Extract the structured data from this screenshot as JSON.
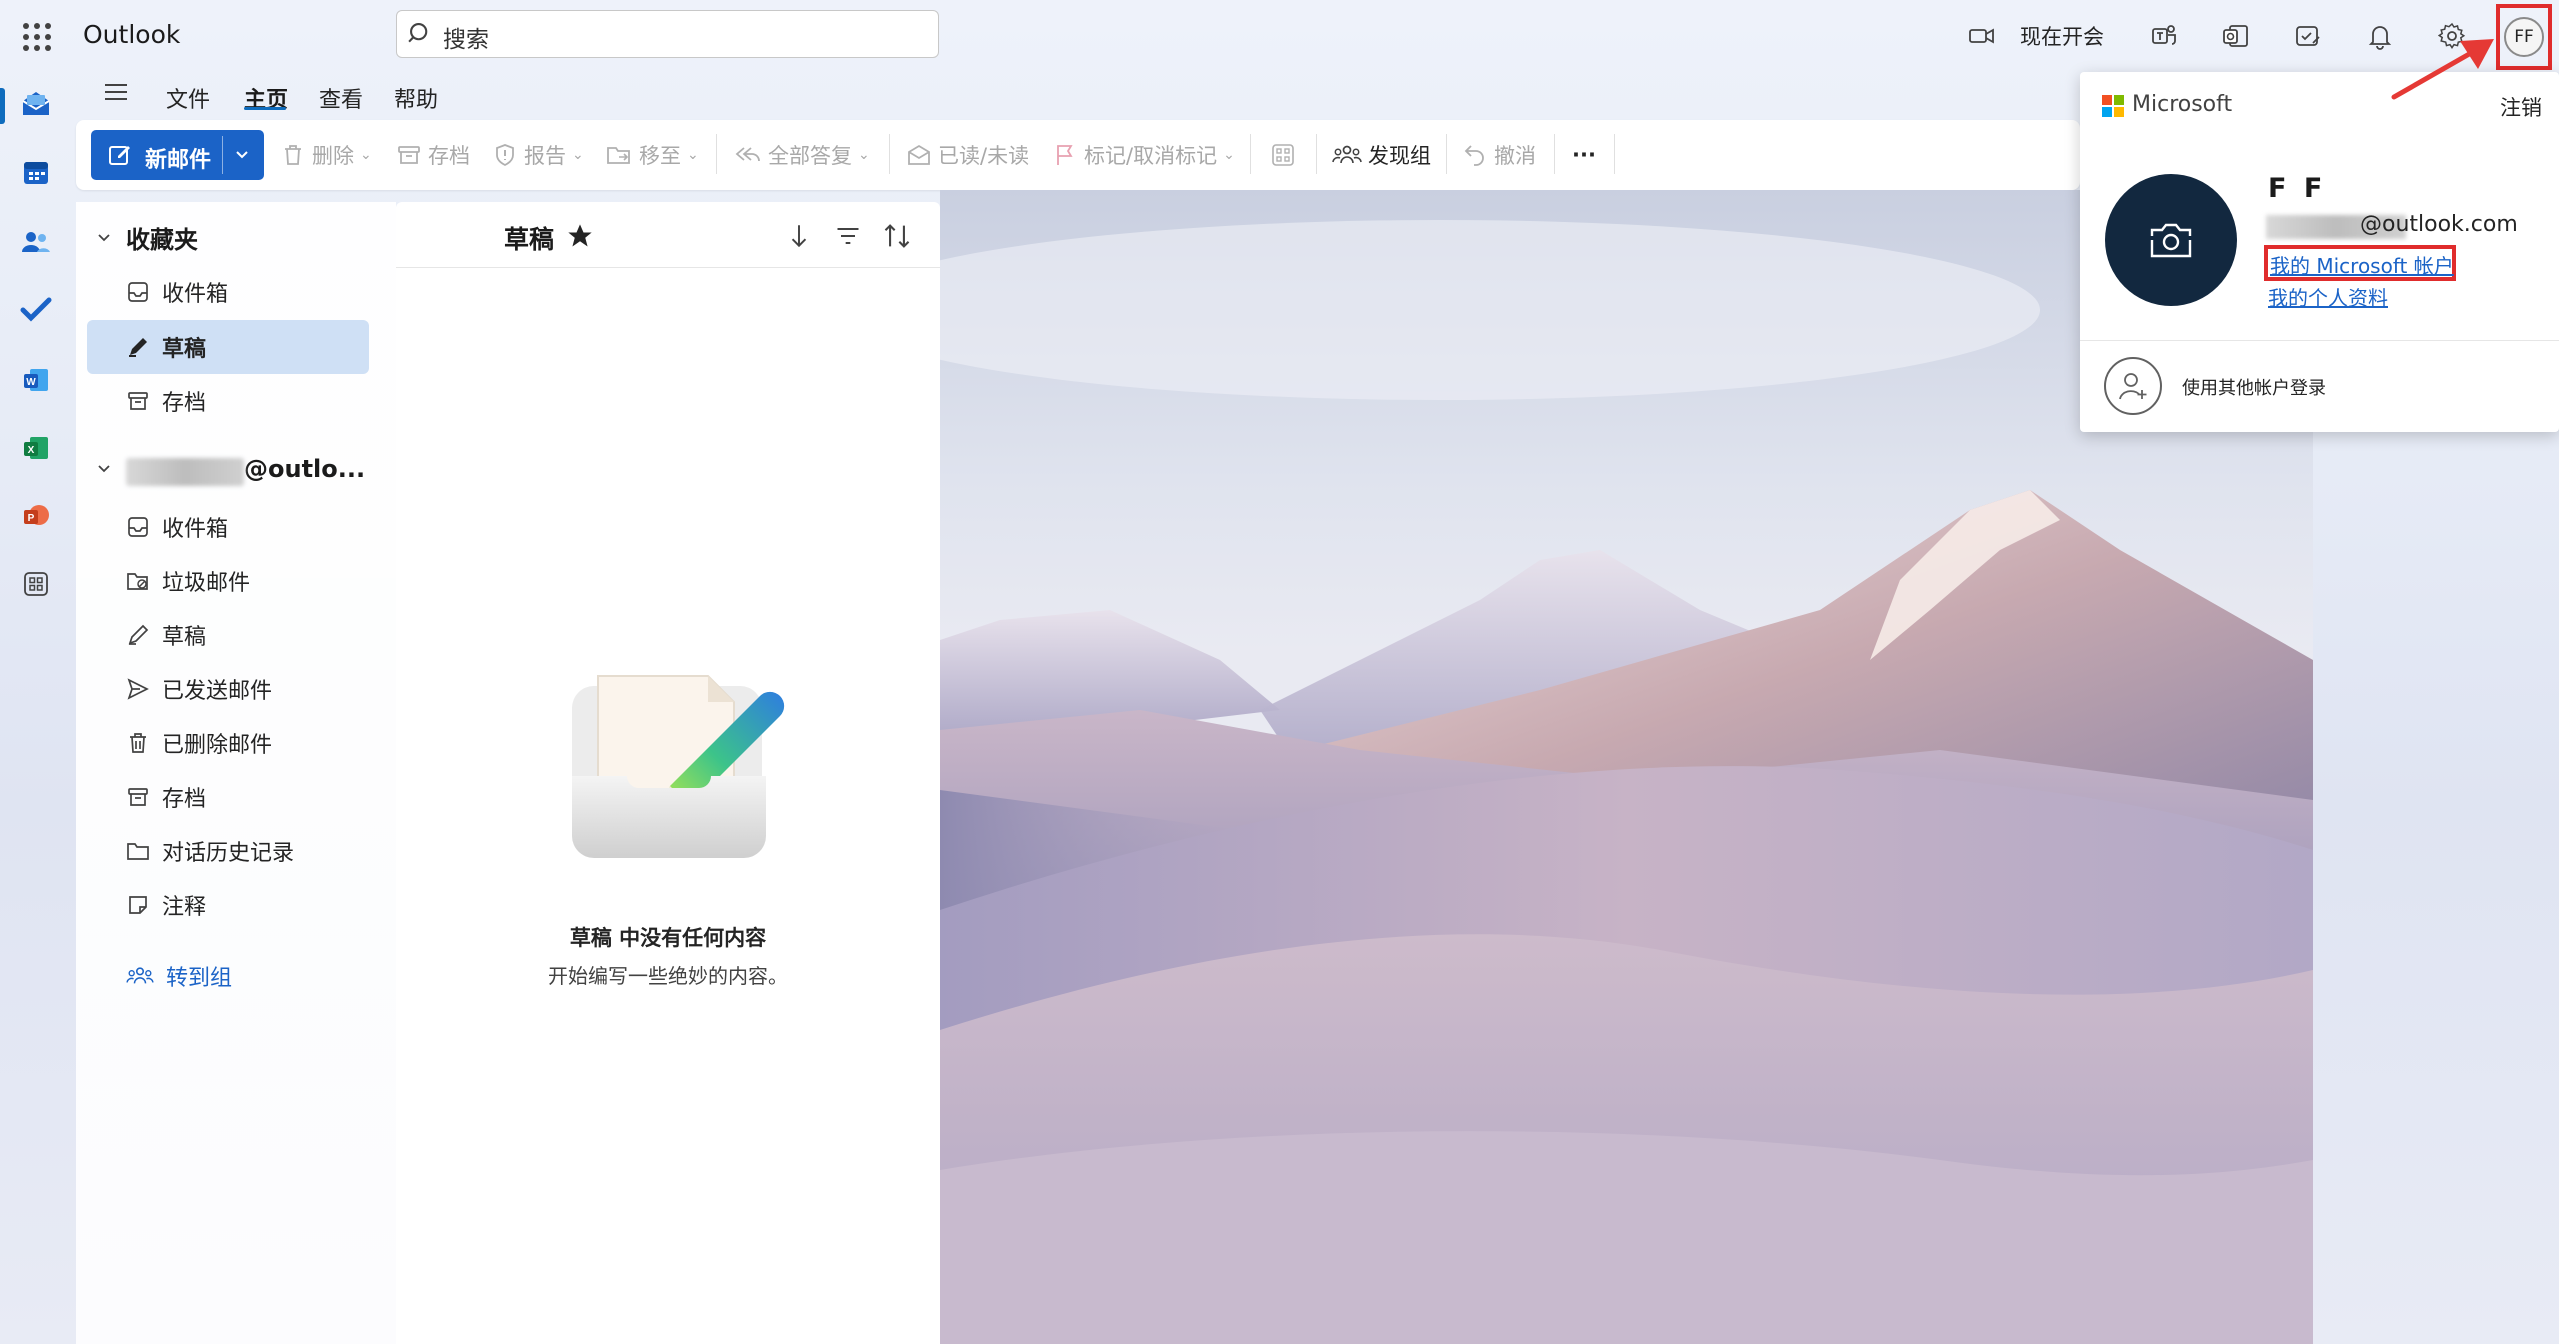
{
  "app": {
    "brand": "Outlook"
  },
  "search": {
    "placeholder": "搜索"
  },
  "topbar": {
    "meet_now": "现在开会",
    "avatar_initials": "FF"
  },
  "menu": {
    "tabs": [
      "文件",
      "主页",
      "查看",
      "帮助"
    ],
    "active_tab": "主页"
  },
  "ribbon": {
    "new_mail": "新邮件",
    "delete": "删除",
    "archive": "存档",
    "report": "报告",
    "move": "移至",
    "reply_all": "全部答复",
    "read_unread": "已读/未读",
    "flag": "标记/取消标记",
    "discover_groups": "发现组",
    "undo": "撤消",
    "more": "···"
  },
  "folders": {
    "favorites_title": "收藏夹",
    "favorites": [
      "收件箱",
      "草稿",
      "存档"
    ],
    "selected": "草稿",
    "account_title": "@outlo...",
    "account_folders": [
      "收件箱",
      "垃圾邮件",
      "草稿",
      "已发送邮件",
      "已删除邮件",
      "存档",
      "对话历史记录",
      "注释"
    ],
    "go_to_groups": "转到组"
  },
  "message_list": {
    "title": "草稿",
    "empty_title": "草稿 中没有任何内容",
    "empty_subtitle": "开始编写一些绝妙的内容。"
  },
  "account_flyout": {
    "provider": "Microsoft",
    "sign_out": "注销",
    "display_name": "F F",
    "email_suffix": "@outlook.com",
    "my_account_link": "我的 Microsoft 帐户",
    "my_profile_link": "我的个人资料",
    "sign_in_other": "使用其他帐户登录"
  },
  "colors": {
    "accent": "#1b63c7",
    "highlight": "#e02c2c",
    "avatar_bg": "#12283f",
    "selected_bg": "#cfe0f5"
  }
}
